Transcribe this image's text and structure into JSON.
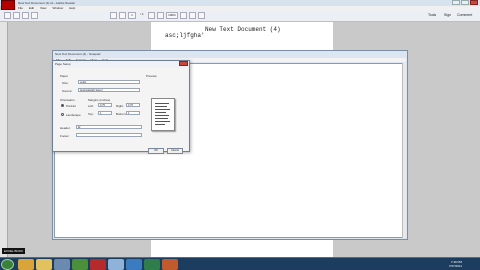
{
  "app": {
    "title": "New Text Document (4).txt - Adobe Reader",
    "menu": [
      "File",
      "Edit",
      "View",
      "Window",
      "Help"
    ],
    "toolbar": {
      "page": "1",
      "page_total": "/ 1",
      "zoom": "100%",
      "tools": "Tools",
      "sign": "Sign",
      "comment": "Comment"
    }
  },
  "document": {
    "title": "New Text Document (4)",
    "body": "asc;ljfgha'"
  },
  "notepad": {
    "title": "New Text Document (4) - Notepad",
    "menu": [
      "File",
      "Edit",
      "Format",
      "View",
      "Help"
    ]
  },
  "dialog": {
    "title": "Page Setup",
    "paper_label": "Paper",
    "size_label": "Size:",
    "size_value": "Letter",
    "source_label": "Source:",
    "source_value": "Automatically Select",
    "orientation_label": "Orientation",
    "portrait_label": "Portrait",
    "landscape_label": "Landscape",
    "margins_label": "Margins (inches)",
    "left_label": "Left:",
    "left_value": "0.75",
    "right_label": "Right:",
    "right_value": "0.75",
    "top_label": "Top:",
    "top_value": "1",
    "bottom_label": "Bottom:",
    "bottom_value": "1",
    "header_label": "Header:",
    "header_value": "&f",
    "footer_label": "Footer:",
    "footer_value": "",
    "preview_label": "Preview",
    "ok_label": "OK",
    "cancel_label": "Cancel"
  },
  "taskbar": {
    "time": "7:39 PM",
    "date": "7/27/2011"
  },
  "overlay": {
    "label": "EXCEL BOOK"
  },
  "colors": {
    "reader_red": "#b40000",
    "taskbar": "#1c3d5e",
    "dialog_bg": "#eef2f7"
  }
}
